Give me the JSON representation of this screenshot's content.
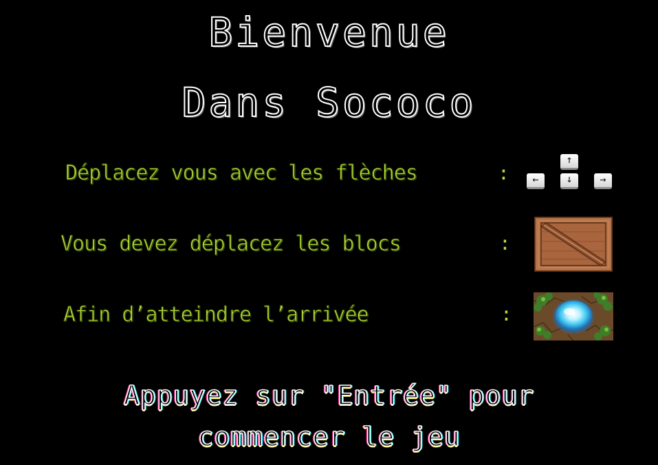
{
  "title": {
    "line1": "Bienvenue",
    "line2": "Dans Sococo"
  },
  "instructions": [
    {
      "text": "Déplacez vous avec les flèches",
      "colon": ":",
      "icon": "arrow-keys-icon"
    },
    {
      "text": "Vous devez déplacez les blocs",
      "colon": ":",
      "icon": "crate-icon"
    },
    {
      "text": "Afin d’atteindre l’arrivée",
      "colon": ":",
      "icon": "goal-portal-icon"
    }
  ],
  "keys": {
    "up": "↑",
    "left": "←",
    "down": "↓",
    "right": "→"
  },
  "prompt": {
    "line1": "Appuyez sur \"Entrée\" pour",
    "line2": "commencer le jeu"
  },
  "colors": {
    "background": "#000000",
    "title": "#ffffff",
    "instruction": "#b4dc3c",
    "crate": "#b5734a",
    "goal": "#3fc6f0"
  }
}
